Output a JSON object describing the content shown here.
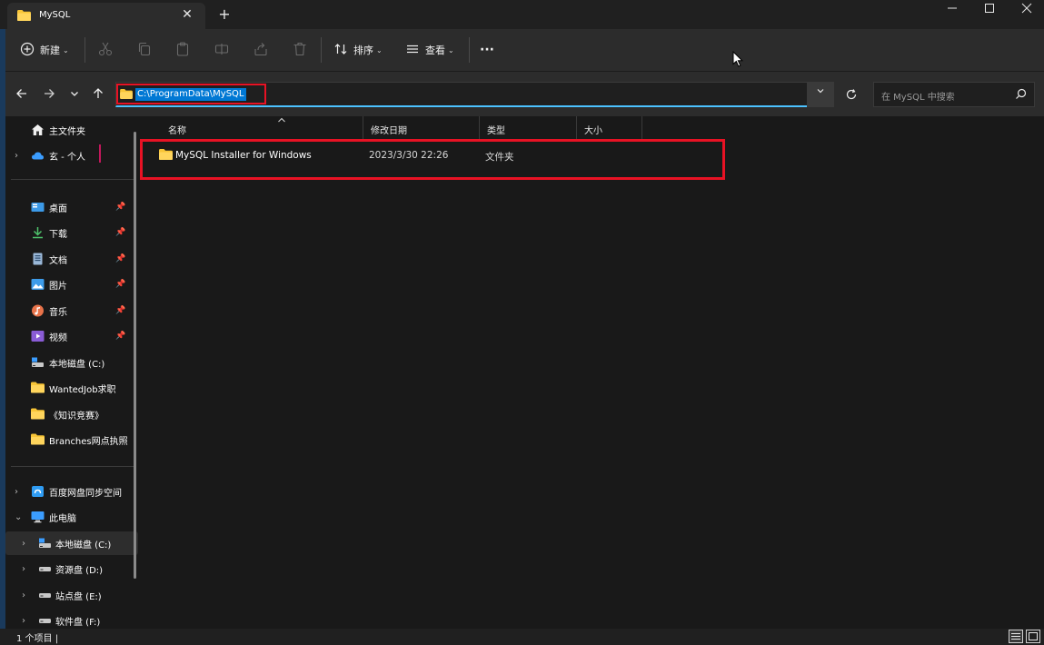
{
  "window": {
    "tab_title": "MySQL",
    "tab_close": "✕",
    "new_tab": "+",
    "minimize": "—",
    "maximize": "☐",
    "close": "✕"
  },
  "toolbar": {
    "new_label": "新建",
    "sort_label": "排序",
    "view_label": "查看",
    "more_label": "···",
    "icons": [
      "cut-icon",
      "copy-icon",
      "paste-icon",
      "rename-icon",
      "share-icon",
      "delete-icon"
    ]
  },
  "address": {
    "path": "C:\\ProgramData\\MySQL",
    "search_placeholder": "在 MySQL 中搜索"
  },
  "sidebar": {
    "items": [
      {
        "label": "主文件夹",
        "icon": "home-icon",
        "pinned": false
      },
      {
        "label": "玄 - 个人",
        "icon": "cloud-icon",
        "pinned": false
      },
      {
        "label": "桌面",
        "icon": "desktop-icon",
        "pinned": true
      },
      {
        "label": "下载",
        "icon": "download-icon",
        "pinned": true
      },
      {
        "label": "文档",
        "icon": "document-icon",
        "pinned": true
      },
      {
        "label": "图片",
        "icon": "picture-icon",
        "pinned": true
      },
      {
        "label": "音乐",
        "icon": "music-icon",
        "pinned": true
      },
      {
        "label": "视频",
        "icon": "video-icon",
        "pinned": true
      },
      {
        "label": "本地磁盘 (C:)",
        "icon": "drive-icon",
        "pinned": false
      },
      {
        "label": "WantedJob求职",
        "icon": "folder-icon",
        "pinned": false
      },
      {
        "label": "《知识竞赛》",
        "icon": "folder-icon",
        "pinned": false
      },
      {
        "label": "Branches网点执照",
        "icon": "folder-icon",
        "pinned": false
      },
      {
        "label": "百度网盘同步空间",
        "icon": "baidu-icon",
        "pinned": false
      },
      {
        "label": "此电脑",
        "icon": "computer-icon",
        "pinned": false
      },
      {
        "label": "本地磁盘 (C:)",
        "icon": "drive-icon",
        "pinned": false
      },
      {
        "label": "资源盘 (D:)",
        "icon": "drive-icon",
        "pinned": false
      },
      {
        "label": "站点盘 (E:)",
        "icon": "drive-icon",
        "pinned": false
      },
      {
        "label": "软件盘 (F:)",
        "icon": "drive-icon",
        "pinned": false
      }
    ]
  },
  "columns": {
    "name": "名称",
    "modified": "修改日期",
    "type": "类型",
    "size": "大小"
  },
  "files": [
    {
      "name": "MySQL Installer for Windows",
      "modified": "2023/3/30 22:26",
      "type": "文件夹",
      "size": ""
    }
  ],
  "status": {
    "count": "1 个项目  |"
  },
  "colors": {
    "accent": "#4cc2ff",
    "highlight_red": "#e81224",
    "folder": "#f8c537"
  }
}
